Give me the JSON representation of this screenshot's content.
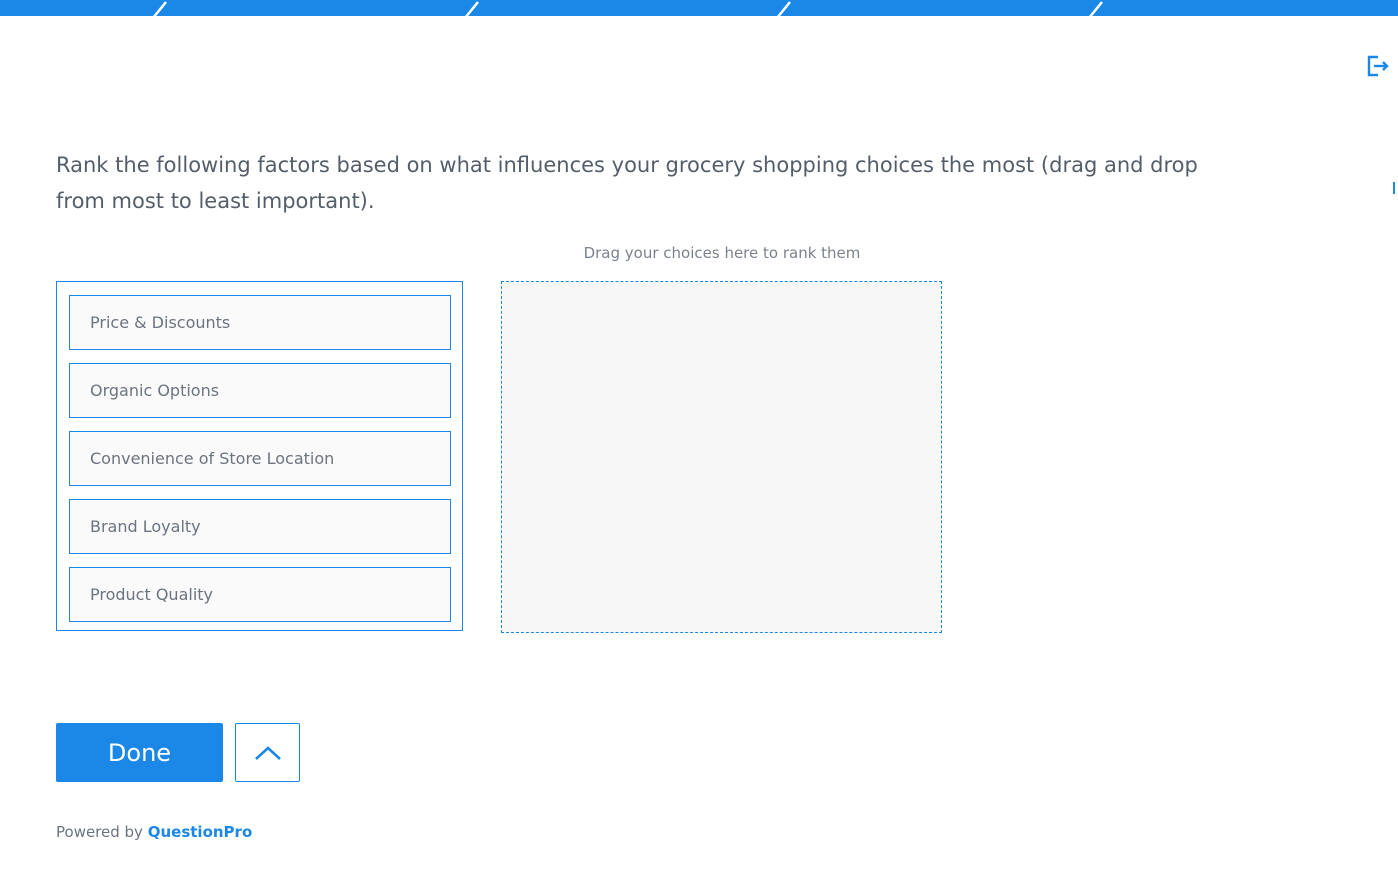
{
  "question": {
    "text": "Rank the following factors based on what influences your grocery shopping choices the most (drag and drop from most to least important)."
  },
  "ranking": {
    "choices": [
      "Price & Discounts",
      "Organic Options",
      "Convenience of Store Location",
      "Brand Loyalty",
      "Product Quality"
    ],
    "drop_zone_label": "Drag your choices here to rank them"
  },
  "navigation": {
    "done_label": "Done",
    "previous_icon": "chevron-up-icon",
    "exit_icon": "exit-icon"
  },
  "footer": {
    "powered_by": "Powered by",
    "brand": "QuestionPro"
  },
  "colors": {
    "accent": "#1b87e6",
    "text": "#545e6b",
    "drop_zone_bg": "#f7f7f7"
  }
}
